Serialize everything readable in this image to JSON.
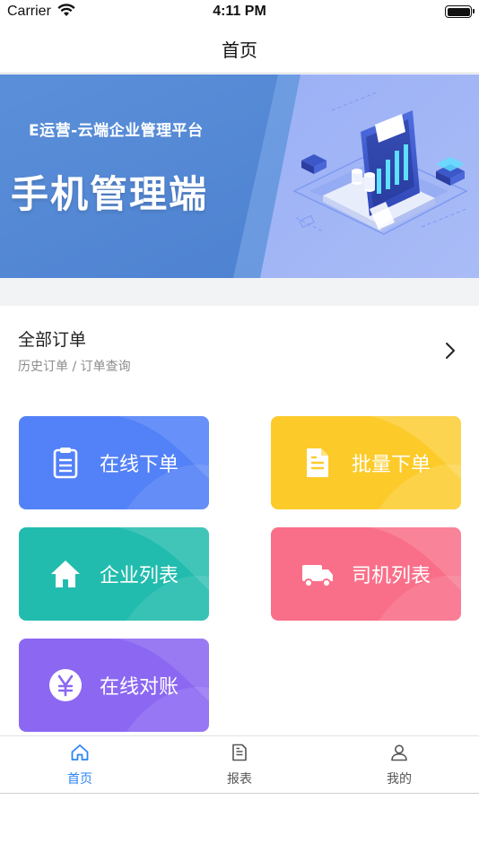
{
  "status_bar": {
    "carrier": "Carrier",
    "time": "4:11 PM"
  },
  "nav": {
    "title": "首页"
  },
  "banner": {
    "subtitle": "E运营-云端企业管理平台",
    "title": "手机管理端"
  },
  "orders": {
    "title": "全部订单",
    "subtitle": "历史订单 / 订单查询"
  },
  "tiles": [
    {
      "label": "在线下单",
      "icon": "clipboard-icon",
      "color": "#5381f7"
    },
    {
      "label": "批量下单",
      "icon": "document-icon",
      "color": "#fccb2a"
    },
    {
      "label": "企业列表",
      "icon": "home-icon",
      "color": "#22bcae"
    },
    {
      "label": "司机列表",
      "icon": "truck-icon",
      "color": "#f96f89"
    },
    {
      "label": "在线对账",
      "icon": "yen-icon",
      "color": "#8c68f2"
    }
  ],
  "tab_bar": {
    "items": [
      {
        "label": "首页",
        "icon": "home-outline-icon",
        "active": true
      },
      {
        "label": "报表",
        "icon": "report-icon",
        "active": false
      },
      {
        "label": "我的",
        "icon": "user-icon",
        "active": false
      }
    ],
    "active_color": "#2d86f5"
  }
}
